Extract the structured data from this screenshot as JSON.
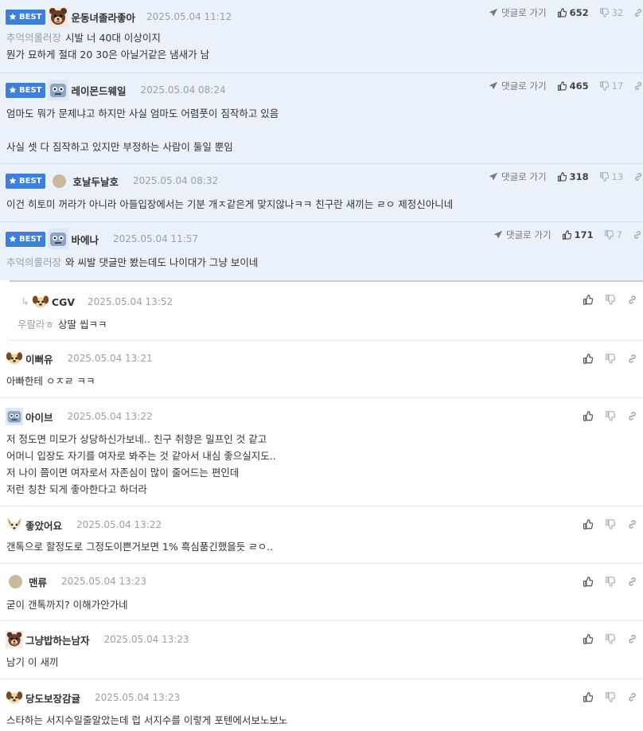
{
  "best_badge": "BEST",
  "reply_to_label": "댓글로 가기",
  "best_comments": [
    {
      "nick": "운동녀졸라좋아",
      "date": "2025.05.04 11:12",
      "likes": "652",
      "dislikes": "32",
      "mention": "추억의롤러장",
      "lines": [
        "시발 너 40대 이상이지",
        "뭔가 묘하게 절대 20 30은 아닐거같은 냄새가 남"
      ]
    },
    {
      "nick": "레이몬드웨일",
      "date": "2025.05.04 08:24",
      "likes": "465",
      "dislikes": "17",
      "mention": "",
      "lines": [
        "엄마도 뭐가 문제냐고 하지만 사실 엄마도 어렴풋이 짐작하고 있음",
        "",
        "사실 셋 다 짐작하고 있지만 부정하는 사람이 둘일 뿐임"
      ]
    },
    {
      "nick": "호날두날호",
      "date": "2025.05.04 08:32",
      "likes": "318",
      "dislikes": "13",
      "mention": "",
      "lines": [
        "이건 히토미 꺼라가 아니라 아들입장에서는 기분 개ㅈ같은게 맞지않나ㅋㅋ 친구란 새끼는 ㄹㅇ 제정신아니네"
      ]
    },
    {
      "nick": "바에나",
      "date": "2025.05.04 11:57",
      "likes": "171",
      "dislikes": "7",
      "mention": "추억의롤러장",
      "lines": [
        "와 씨발 댓글만 봤는데도 나이대가 그냥 보이네"
      ]
    }
  ],
  "comments": [
    {
      "nick": "CGV",
      "date": "2025.05.04 13:52",
      "mention": "우랄라ㅎ",
      "lines": [
        "상딸 씹ㅋㅋ"
      ]
    },
    {
      "nick": "이뻐유",
      "date": "2025.05.04 13:21",
      "mention": "",
      "lines": [
        "아빠한테 ㅇㅈㄹ ㅋㅋ"
      ]
    },
    {
      "nick": "아이브",
      "date": "2025.05.04 13:22",
      "mention": "",
      "lines": [
        "저 정도면 미모가 상당하신가보네.. 친구 취향은 밀프인 것 같고",
        "어머니 입장도 자기를 여자로 봐주는 것 같아서 내심 좋으실지도..",
        "저 나이 쯤이면 여자로서 자존심이 많이 줄어드는 편인데",
        "저런 칭찬 되게 좋아한다고 하더라"
      ]
    },
    {
      "nick": "좋았어요",
      "date": "2025.05.04 13:22",
      "mention": "",
      "lines": [
        "갠톡으로 할정도로 그정도이쁜거보면 1% 흑심품긴했을듯 ㄹㅇ.."
      ]
    },
    {
      "nick": "맨류",
      "date": "2025.05.04 13:23",
      "mention": "",
      "lines": [
        "굳이 갠톡까지? 이해가안가네"
      ]
    },
    {
      "nick": "그냥밥하는남자",
      "date": "2025.05.04 13:23",
      "mention": "",
      "lines": [
        "남기 이 새끼"
      ]
    },
    {
      "nick": "당도보장감귤",
      "date": "2025.05.04 13:23",
      "mention": "",
      "lines": [
        "스타하는 서지수일줄알았는데 럽 서지수를 이렇게 포텐에서보노보노"
      ]
    }
  ],
  "colors": {
    "best_bg": "#eaf1fb",
    "badge": "#3d7fd9"
  }
}
